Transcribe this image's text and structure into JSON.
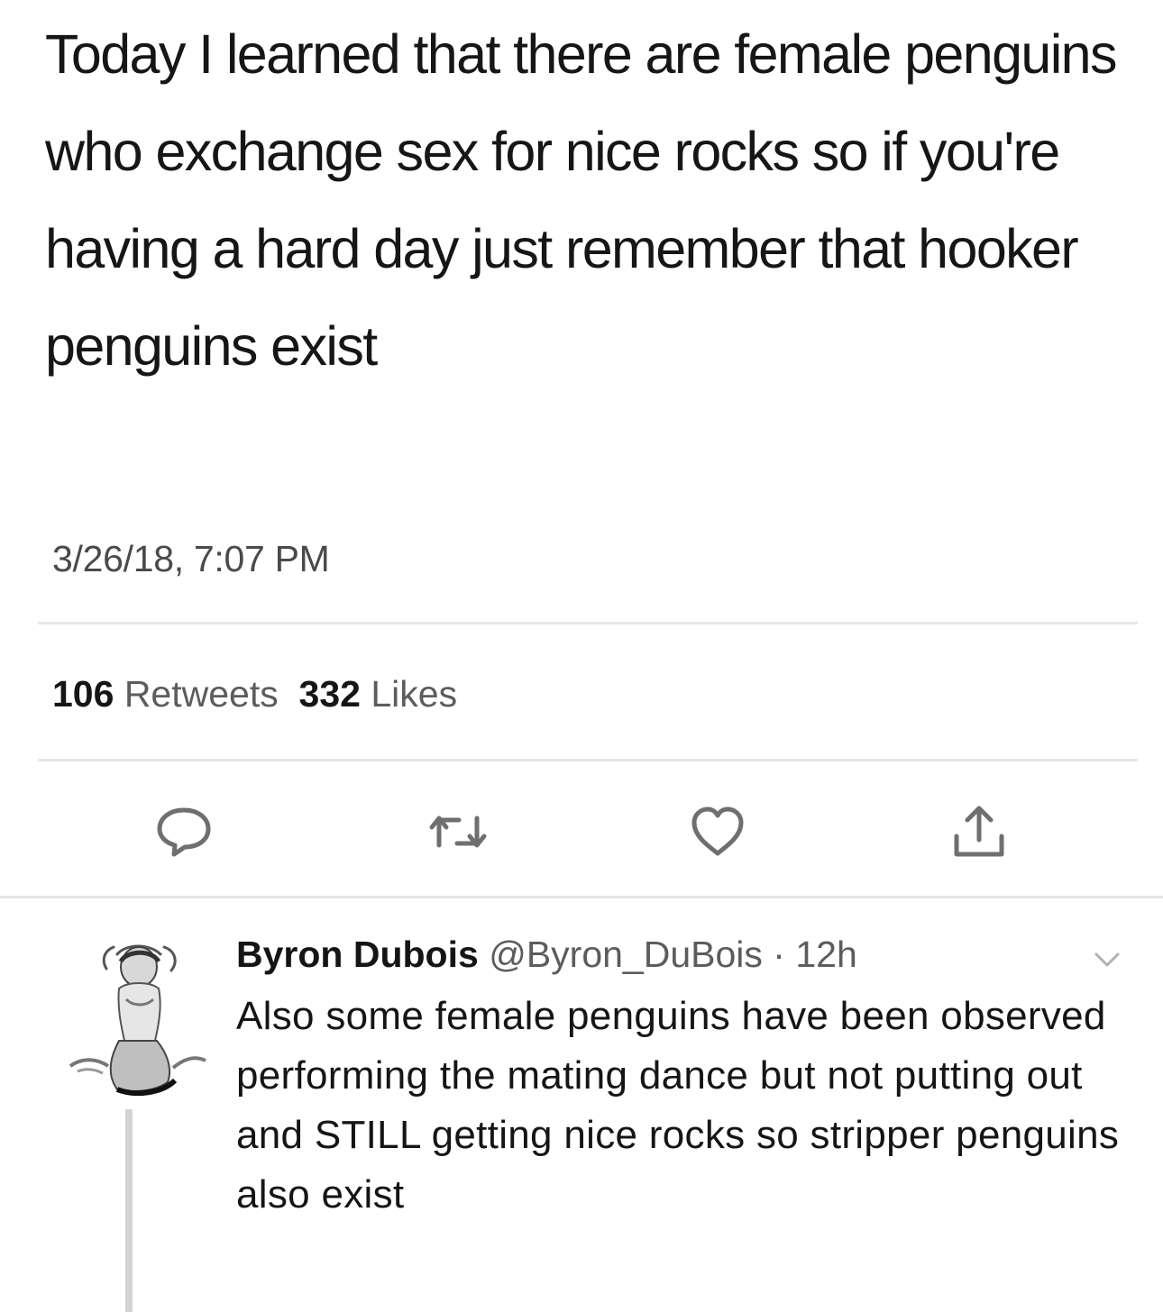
{
  "tweet": {
    "text": "Today I learned that there are female penguins who exchange sex for nice rocks so if you're having a hard day just remember that hooker penguins exist",
    "timestamp": "3/26/18, 7:07 PM",
    "retweets_count": "106",
    "retweets_label": "Retweets",
    "likes_count": "332",
    "likes_label": "Likes",
    "actions": [
      {
        "name": "reply",
        "icon": "speech-bubble-icon"
      },
      {
        "name": "retweet",
        "icon": "retweet-icon"
      },
      {
        "name": "like",
        "icon": "heart-icon"
      },
      {
        "name": "share",
        "icon": "share-icon"
      }
    ]
  },
  "reply": {
    "name": "Byron Dubois",
    "handle_time": "@Byron_DuBois · 12h",
    "text": "Also some female penguins have been observed performing the mating dance but not putting out and STILL getting nice rocks so stripper penguins also exist",
    "menu_icon": "chevron-down-icon"
  },
  "colors": {
    "background": "#ffffff",
    "text": "#161616",
    "secondary_text": "#5c5c5c",
    "divider": "#e6e6e6",
    "icon": "#6f6f6f"
  }
}
